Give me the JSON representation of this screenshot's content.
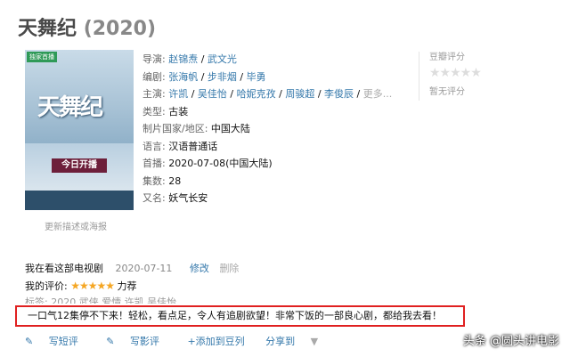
{
  "title": {
    "name": "天舞纪",
    "year": "(2020)"
  },
  "poster": {
    "badge": "独家首播",
    "title_art": "天舞纪",
    "banner": "今日开播"
  },
  "more_link": "更新描述或海报",
  "info": {
    "director_label": "导演:",
    "directors": [
      "赵锦焘",
      "武文光"
    ],
    "writer_label": "编剧:",
    "writers": [
      "张海帆",
      "步非烟",
      "毕勇"
    ],
    "cast_label": "主演:",
    "cast": [
      "许凯",
      "吴佳怡",
      "哈妮克孜",
      "周骏超",
      "李俊辰"
    ],
    "cast_more": "更多...",
    "type_label": "类型:",
    "type_value": "古装",
    "region_label": "制片国家/地区:",
    "region_value": "中国大陆",
    "lang_label": "语言:",
    "lang_value": "汉语普通话",
    "premiere_label": "首播:",
    "premiere_value": "2020-07-08(中国大陆)",
    "episodes_label": "集数:",
    "episodes_value": "28",
    "aka_label": "又名:",
    "aka_value": "妖气长安"
  },
  "rating": {
    "label": "豆瓣评分",
    "stars": "★★★★★",
    "none": "暂无评分"
  },
  "status": {
    "watching": "我在看这部电视剧",
    "date": "2020-07-11",
    "edit": "修改",
    "delete": "删除",
    "my_rating_label": "我的评价:",
    "my_stars": "★★★★★",
    "my_rating_word": "力荐",
    "my_rating_value": 5,
    "tags": "标签: 2020 武侠 爱情 许凯 吴佳怡"
  },
  "comment": "一口气12集停不下来！轻松，看点足，令人有追剧欲望！非常下饭的一部良心剧，都给我去看！",
  "actions": {
    "short": "写短评",
    "review": "写影评",
    "add_list": "+添加到豆列",
    "share": "分享到",
    "share_arrow": "▼"
  },
  "watermark": "头条 @圆头讲电影"
}
